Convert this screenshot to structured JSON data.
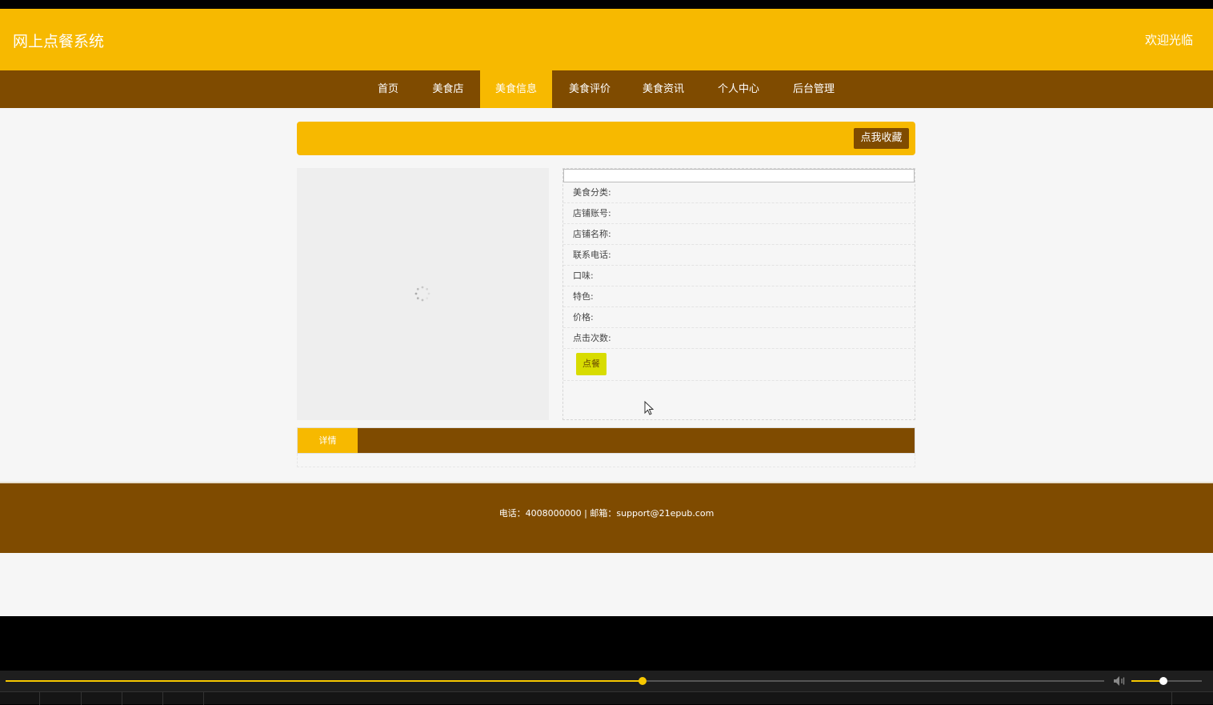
{
  "header": {
    "site_title": "网上点餐系统",
    "welcome": "欢迎光临"
  },
  "nav": {
    "items": [
      {
        "label": "首页"
      },
      {
        "label": "美食店"
      },
      {
        "label": "美食信息"
      },
      {
        "label": "美食评价"
      },
      {
        "label": "美食资讯"
      },
      {
        "label": "个人中心"
      },
      {
        "label": "后台管理"
      }
    ],
    "active": "美食信息"
  },
  "banner": {
    "fav_label": "点我收藏"
  },
  "info": {
    "fields": [
      {
        "label": "美食分类:"
      },
      {
        "label": "店铺账号:"
      },
      {
        "label": "店铺名称:"
      },
      {
        "label": "联系电话:"
      },
      {
        "label": "口味:"
      },
      {
        "label": "特色:"
      },
      {
        "label": "价格:"
      },
      {
        "label": "点击次数:"
      }
    ],
    "order_label": "点餐"
  },
  "tabs": {
    "detail_label": "详情"
  },
  "footer": {
    "text": "电话：4008000000 | 邮箱：support@21epub.com"
  },
  "player": {
    "progress": 0.58,
    "volume": 0.45
  },
  "colors": {
    "primary_yellow": "#f7b900",
    "brown": "#7f4b00",
    "order_button": "#d8dc00"
  }
}
